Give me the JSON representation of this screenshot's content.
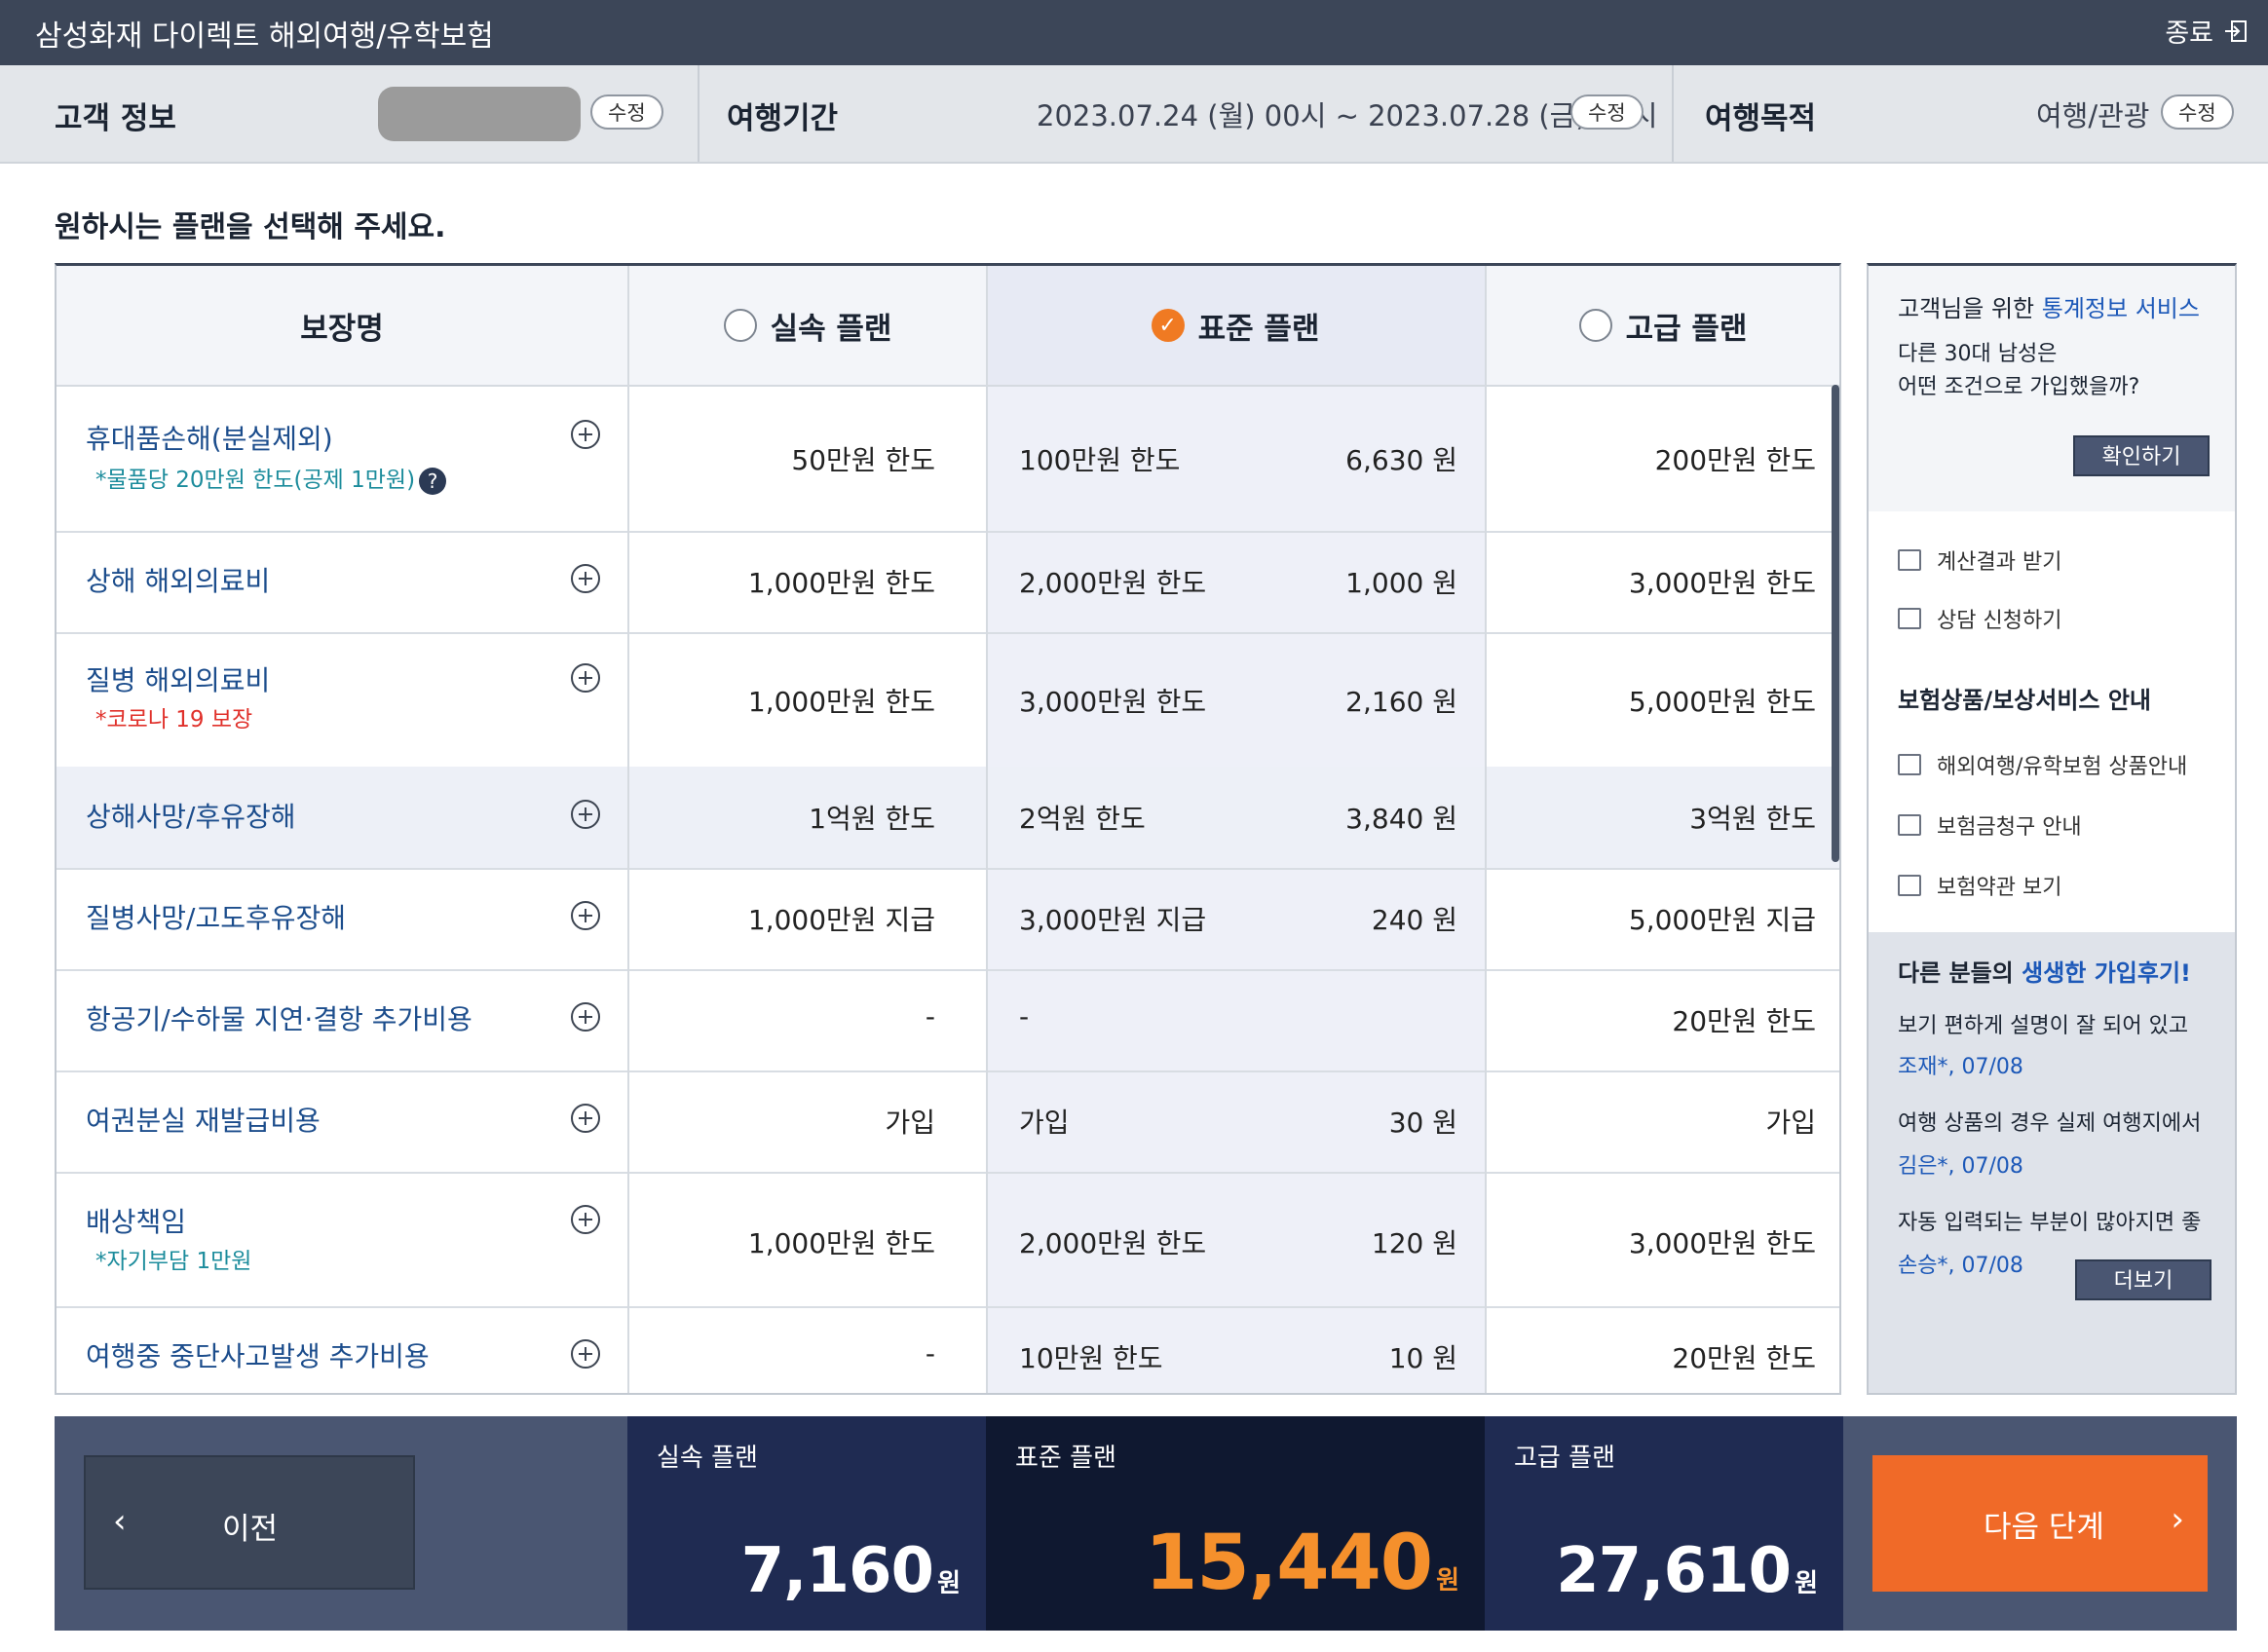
{
  "app": {
    "title": "삼성화재 다이렉트 해외여행/유학보험",
    "exit_label": "종료"
  },
  "info": {
    "customer_label": "고객 정보",
    "period_label": "여행기간",
    "period_value": "2023.07.24 (월) 00시 ~ 2023.07.28 (금) 23시",
    "purpose_label": "여행목적",
    "purpose_value": "여행/관광",
    "edit_label": "수정"
  },
  "heading": "원하시는 플랜을 선택해 주세요.",
  "table": {
    "col_coverage": "보장명",
    "plans": [
      "실속 플랜",
      "표준 플랜",
      "고급 플랜"
    ],
    "selected_plan": "표준 플랜",
    "rows": [
      {
        "name": "휴대품손해(분실제외)",
        "note": "*물품당 20만원 한도(공제 1만원)",
        "basic": "50만원 한도",
        "standard": "100만원 한도",
        "standard_premium": "6,630 원",
        "premium": "200만원 한도"
      },
      {
        "name": "상해 해외의료비",
        "note": "",
        "basic": "1,000만원 한도",
        "standard": "2,000만원 한도",
        "standard_premium": "1,000 원",
        "premium": "3,000만원 한도"
      },
      {
        "name": "질병 해외의료비",
        "note": "*코로나 19 보장",
        "basic": "1,000만원 한도",
        "standard": "3,000만원 한도",
        "standard_premium": "2,160 원",
        "premium": "5,000만원 한도"
      },
      {
        "name": "상해사망/후유장해",
        "note": "",
        "basic": "1억원 한도",
        "standard": "2억원 한도",
        "standard_premium": "3,840 원",
        "premium": "3억원 한도"
      },
      {
        "name": "질병사망/고도후유장해",
        "note": "",
        "basic": "1,000만원 지급",
        "standard": "3,000만원 지급",
        "standard_premium": "240 원",
        "premium": "5,000만원 지급"
      },
      {
        "name": "항공기/수하물 지연·결항 추가비용",
        "note": "",
        "basic": "-",
        "standard": "-",
        "standard_premium": "",
        "premium": "20만원 한도"
      },
      {
        "name": "여권분실 재발급비용",
        "note": "",
        "basic": "가입",
        "standard": "가입",
        "standard_premium": "30 원",
        "premium": "가입"
      },
      {
        "name": "배상책임",
        "note": "*자기부담 1만원",
        "basic": "1,000만원 한도",
        "standard": "2,000만원 한도",
        "standard_premium": "120 원",
        "premium": "3,000만원 한도"
      },
      {
        "name": "여행중 중단사고발생 추가비용",
        "note": "",
        "basic": "-",
        "standard": "10만원 한도",
        "standard_premium": "10 원",
        "premium": "20만원 한도"
      }
    ]
  },
  "sidebar": {
    "stats_title_a": "고객님을 위한 ",
    "stats_title_b": "통계정보 서비스",
    "stats_line1": "다른 30대 남성은",
    "stats_line2": "어떤 조건으로 가입했을까?",
    "confirm_label": "확인하기",
    "links1": [
      "계산결과 받기",
      "상담 신청하기"
    ],
    "guide_title": "보험상품/보상서비스 안내",
    "links2": [
      "해외여행/유학보험 상품안내",
      "보험금청구 안내",
      "보험약관 보기"
    ],
    "reviews_title_a": "다른 분들의 ",
    "reviews_title_b": "생생한 가입후기!",
    "reviews": [
      {
        "text": "보기 편하게 설명이 잘 되어 있고",
        "meta": "조재*, 07/08"
      },
      {
        "text": "여행 상품의 경우 실제 여행지에서",
        "meta": "김은*, 07/08"
      },
      {
        "text": "자동 입력되는 부분이 많아지면 좋",
        "meta": "손승*, 07/08"
      }
    ],
    "more_label": "더보기"
  },
  "footer": {
    "prev_label": "이전",
    "next_label": "다음 단계",
    "currency": "원",
    "plans": [
      {
        "name": "실속 플랜",
        "total": "7,160"
      },
      {
        "name": "표준 플랜",
        "total": "15,440"
      },
      {
        "name": "고급 플랜",
        "total": "27,610"
      }
    ]
  },
  "colors": {
    "accent": "#f07a22",
    "brand_dark": "#3c4658",
    "link": "#1c4d8c"
  }
}
